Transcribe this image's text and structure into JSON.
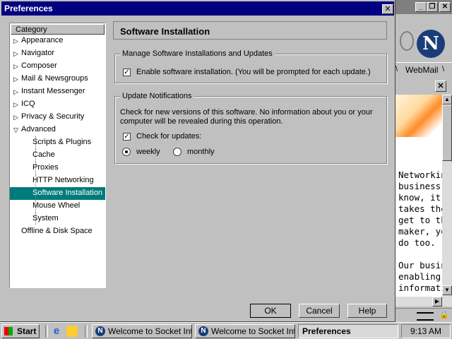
{
  "dialog": {
    "title": "Preferences"
  },
  "category": {
    "header": "Category",
    "items": [
      {
        "label": "Appearance",
        "level": 0,
        "arrow": "▷"
      },
      {
        "label": "Navigator",
        "level": 0,
        "arrow": "▷"
      },
      {
        "label": "Composer",
        "level": 0,
        "arrow": "▷"
      },
      {
        "label": "Mail & Newsgroups",
        "level": 0,
        "arrow": "▷"
      },
      {
        "label": "Instant Messenger",
        "level": 0,
        "arrow": "▷"
      },
      {
        "label": "ICQ",
        "level": 0,
        "arrow": "▷"
      },
      {
        "label": "Privacy & Security",
        "level": 0,
        "arrow": "▷"
      },
      {
        "label": "Advanced",
        "level": 0,
        "arrow": "▽"
      },
      {
        "label": "Scripts & Plugins",
        "level": 1
      },
      {
        "label": "Cache",
        "level": 1
      },
      {
        "label": "Proxies",
        "level": 1
      },
      {
        "label": "HTTP Networking",
        "level": 1
      },
      {
        "label": "Software Installation",
        "level": 1,
        "selected": true
      },
      {
        "label": "Mouse Wheel",
        "level": 1
      },
      {
        "label": "System",
        "level": 1
      },
      {
        "label": "Offline & Disk Space",
        "level": 0
      }
    ]
  },
  "panel": {
    "title": "Software Installation",
    "manage": {
      "legend": "Manage Software Installations and Updates",
      "enable_label": "Enable software installation. (You will be prompted for each update.)",
      "enable_checked": true
    },
    "notify": {
      "legend": "Update Notifications",
      "desc_line1": "Check for new versions of this software. No information about you or your",
      "desc_line2": "computer will be revealed during this operation.",
      "check_label": "Check for updates:",
      "check_checked": true,
      "weekly_label": "weekly",
      "monthly_label": "monthly",
      "selected": "weekly"
    }
  },
  "buttons": {
    "ok": "OK",
    "cancel": "Cancel",
    "help": "Help"
  },
  "background_window": {
    "webmail": "WebMail",
    "lines": [
      "Networkin",
      "business.",
      "know, it's",
      "takes the",
      "get to th",
      "maker, yo",
      "do too.",
      "",
      "Our busin",
      "enabling ",
      "informatio"
    ]
  },
  "taskbar": {
    "start": "Start",
    "tasks": [
      "Welcome to Socket Int...",
      "Welcome to Socket Int...",
      "Preferences"
    ],
    "clock": "9:13 AM"
  },
  "colors": {
    "titlebar": "#000080",
    "selection": "#007b7b",
    "face": "#c0c0c0"
  }
}
